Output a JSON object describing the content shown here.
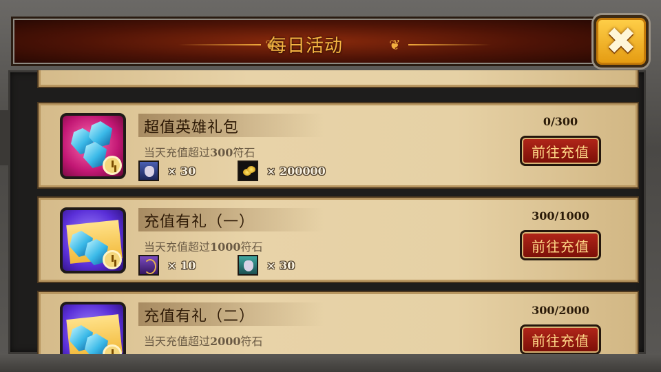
{
  "window": {
    "title": "每日活动",
    "close_icon": "close-x-icon"
  },
  "cards": [
    {
      "title": "超值英雄礼包",
      "desc_prefix": "当天充值超过",
      "desc_amount": "300",
      "desc_suffix": "符石",
      "progress": "0/300",
      "button": "前往充值",
      "icon": "gem-bag-icon",
      "rewards": [
        {
          "icon": "hero-portrait-icon",
          "qty": "× 30"
        },
        {
          "icon": "gold-coins-icon",
          "qty": "× 200000"
        }
      ]
    },
    {
      "title": "充值有礼（一）",
      "desc_prefix": "当天充值超过",
      "desc_amount": "1000",
      "desc_suffix": "符石",
      "progress": "300/1000",
      "button": "前往充值",
      "icon": "gem-card-icon",
      "rewards": [
        {
          "icon": "whip-icon",
          "qty": "× 10"
        },
        {
          "icon": "hero-portrait-icon",
          "qty": "× 30"
        }
      ]
    },
    {
      "title": "充值有礼（二）",
      "desc_prefix": "当天充值超过",
      "desc_amount": "2000",
      "desc_suffix": "符石",
      "progress": "300/2000",
      "button": "前往充值",
      "icon": "gem-card-icon"
    }
  ],
  "colors": {
    "header_title": "#f6b542",
    "button_bg": "#b3261a",
    "button_text": "#ffd988",
    "close_button": "#ffd04a"
  }
}
